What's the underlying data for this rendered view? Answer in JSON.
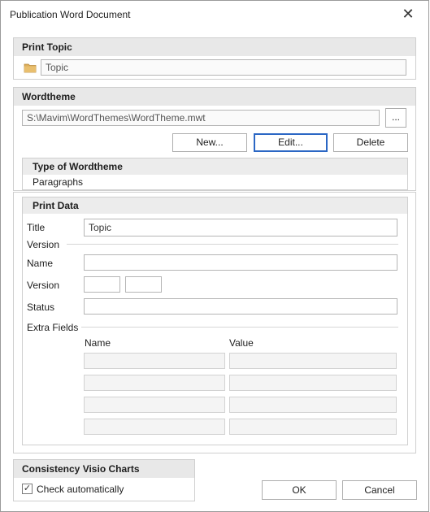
{
  "window": {
    "title": "Publication Word Document"
  },
  "print_topic": {
    "heading": "Print Topic",
    "topic_value": "Topic",
    "icon": "folder-icon"
  },
  "wordtheme": {
    "heading": "Wordtheme",
    "path_value": "S:\\Mavim\\WordThemes\\WordTheme.mwt",
    "browse_label": "...",
    "new_label": "New...",
    "edit_label": "Edit...",
    "delete_label": "Delete",
    "type_heading": "Type of Wordtheme",
    "type_value": "Paragraphs"
  },
  "print_data": {
    "heading": "Print Data",
    "title_label": "Title",
    "title_value": "Topic",
    "version_section": "Version",
    "name_label": "Name",
    "name_value": "",
    "version_label": "Version",
    "version_major": "",
    "version_minor": "",
    "status_label": "Status",
    "status_value": "",
    "extra_fields_section": "Extra Fields",
    "extra_col_name": "Name",
    "extra_col_value": "Value"
  },
  "consistency": {
    "heading": "Consistency Visio Charts",
    "check_label": "Check automatically",
    "checked": true
  },
  "footer": {
    "ok_label": "OK",
    "cancel_label": "Cancel"
  }
}
